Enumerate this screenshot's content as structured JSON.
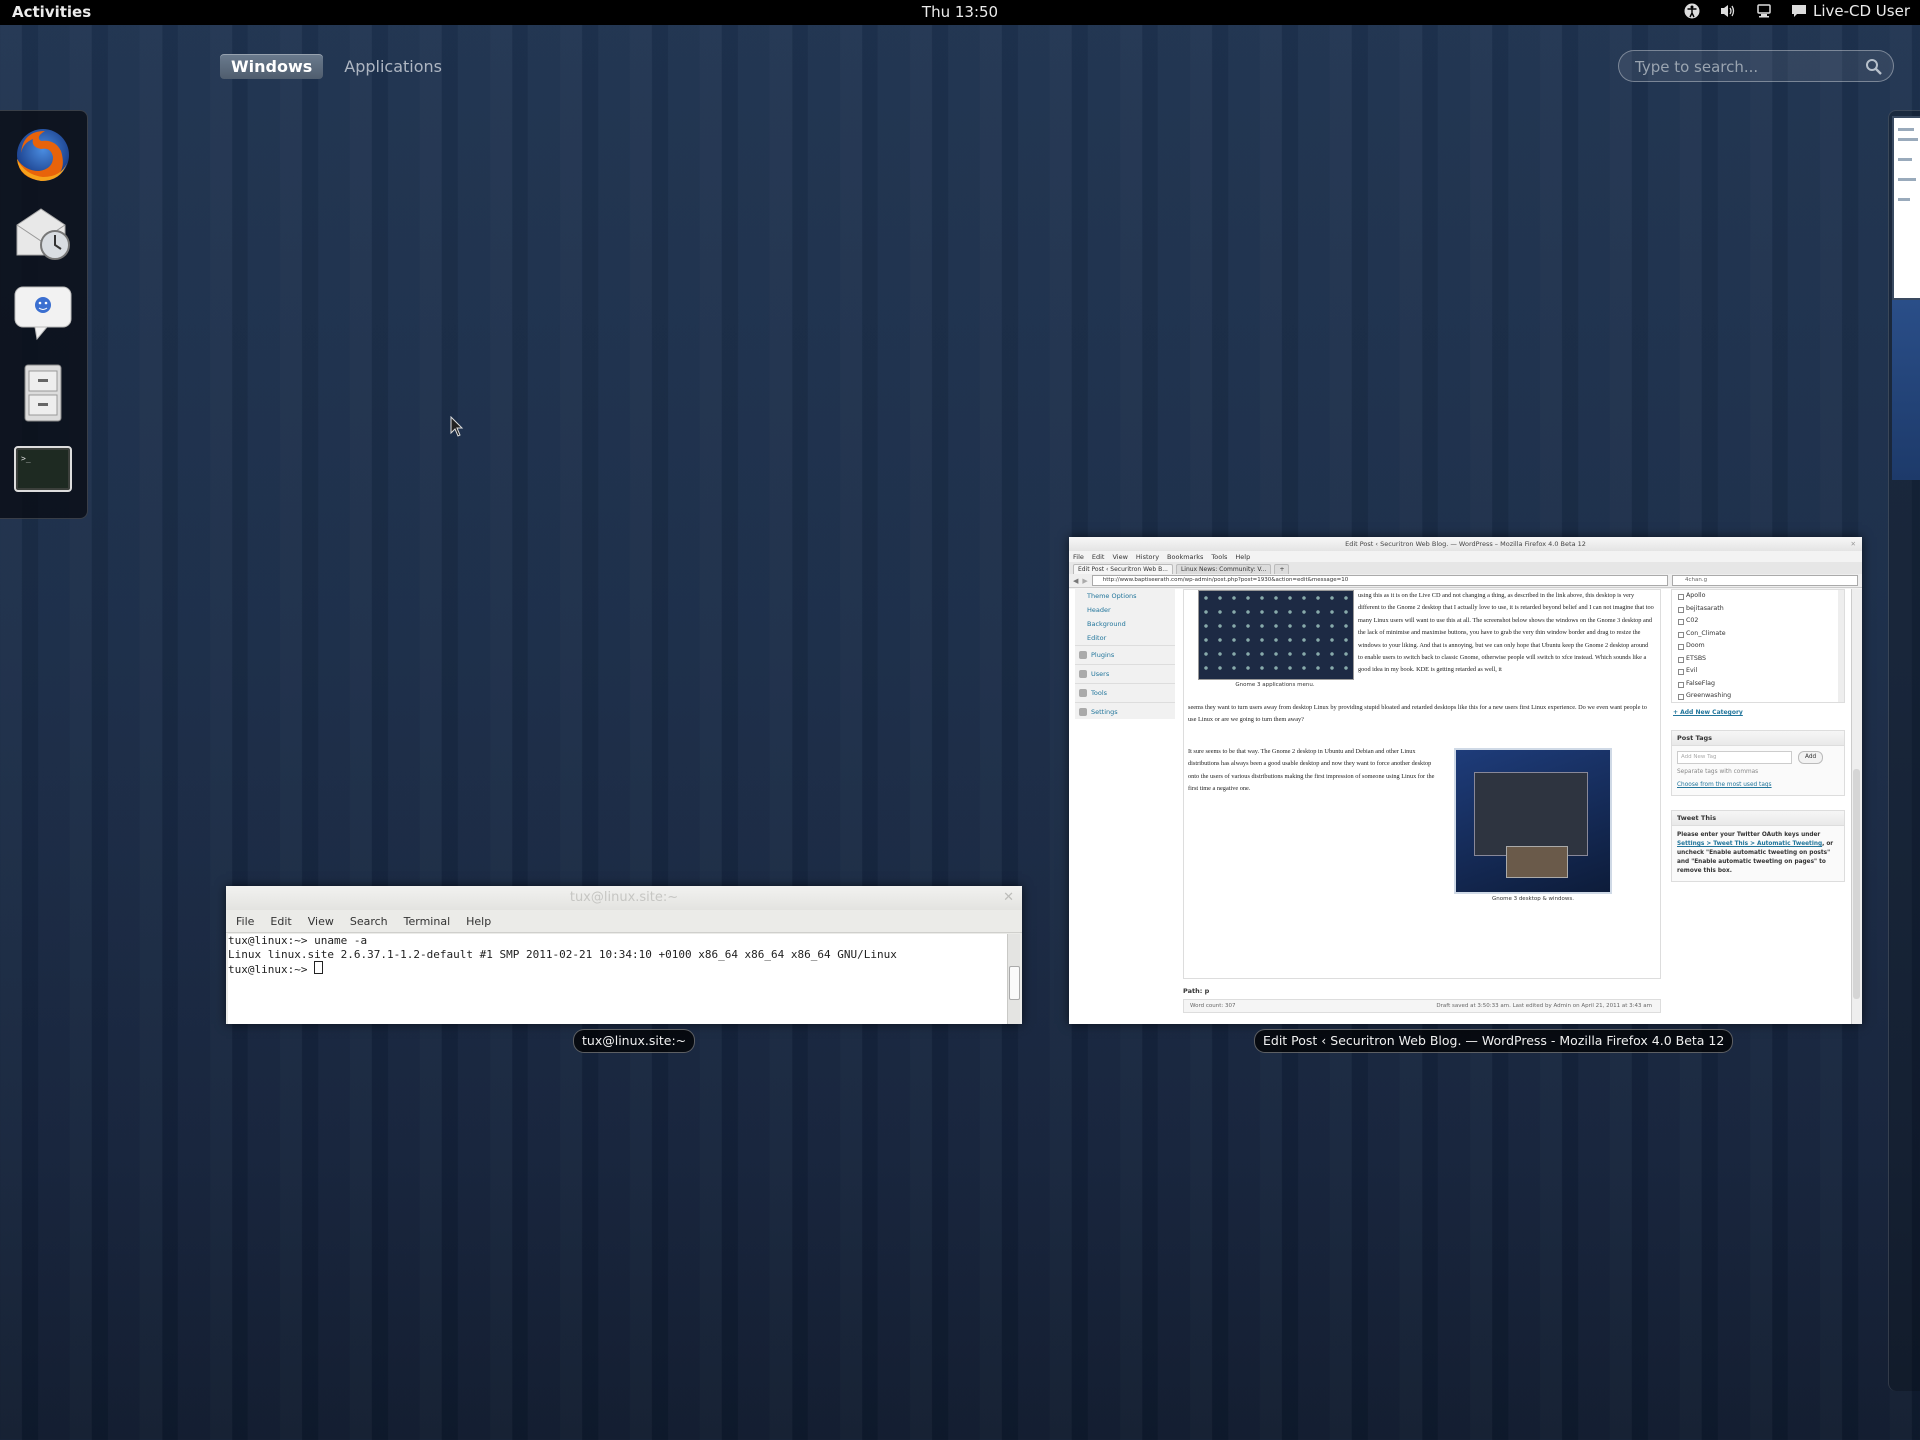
{
  "topbar": {
    "activities": "Activities",
    "clock": "Thu 13:50",
    "user": "Live-CD User",
    "icons": [
      "accessibility-icon",
      "volume-icon",
      "network-icon",
      "user-status-icon"
    ]
  },
  "overview": {
    "tabs": [
      {
        "label": "Windows",
        "active": true
      },
      {
        "label": "Applications",
        "active": false
      }
    ],
    "search_placeholder": "Type to search..."
  },
  "dash": {
    "items": [
      {
        "icon": "firefox-icon"
      },
      {
        "icon": "evolution-mail-icon"
      },
      {
        "icon": "empathy-chat-icon"
      },
      {
        "icon": "file-manager-icon"
      },
      {
        "icon": "terminal-icon"
      }
    ]
  },
  "terminal": {
    "title": "tux@linux.site:~",
    "label": "tux@linux.site:~",
    "menu": [
      "File",
      "Edit",
      "View",
      "Search",
      "Terminal",
      "Help"
    ],
    "lines": [
      "tux@linux:~> uname -a",
      "Linux linux.site 2.6.37.1-1.2-default #1 SMP 2011-02-21 10:34:10 +0100 x86_64 x86_64 x86_64 GNU/Linux",
      "tux@linux:~> "
    ]
  },
  "firefox": {
    "title": "Edit Post ‹ Securitron Web Blog. — WordPress – Mozilla Firefox 4.0 Beta 12",
    "label": "Edit Post ‹ Securitron Web Blog. — WordPress - Mozilla Firefox 4.0 Beta 12",
    "menu": [
      "File",
      "Edit",
      "View",
      "History",
      "Bookmarks",
      "Tools",
      "Help"
    ],
    "tabs": [
      "Edit Post ‹ Securitron Web B...",
      "Linux News: Community: V..."
    ],
    "url": "http://www.baptiseerath.com/wp-admin/post.php?post=1930&action=edit&message=10",
    "search_value": "4chan.g",
    "admin_menu": {
      "sub": [
        "Theme Options",
        "Header",
        "Background",
        "Editor"
      ],
      "main": [
        "Plugins",
        "Users",
        "Tools",
        "Settings"
      ]
    },
    "caption1": "Gnome 3 applications menu.",
    "para1": "using this as it is on the Live CD and not changing a thing, as described in the link above, this desktop is very different to the Gnome 2 desktop that I actually love to use, it is retarded beyond belief and I can not imagine that too many Linux users will want to use this at all. The screenshot below shows the windows on the Gnome 3 desktop and the lack of minimise and maximise buttons, you have to grab the very thin window border and drag to resize the windows to your liking. And that is annoying, but we can only hope that Ubuntu keep the Gnome 2 desktop around to enable users to switch back to classic Gnome, otherwise people will switch to xfce instead. Which sounds like a good idea in my book. KDE is getting retarded as well, it",
    "para1b": "seems they want to turn users away from desktop Linux by providing stupid bloated and retarded desktops like this for a new users first Linux experience. Do we even want people to use Linux or are we going to turn them away?",
    "para2": "It sure seems to be that way. The Gnome 2 desktop in Ubuntu and Debian and other Linux distributions has always been a good usable desktop and now they want to force another desktop onto the users of various distributions making the first impression of someone using Linux for the first time a negative one.",
    "caption2": "Gnome 3 desktop & windows.",
    "path": "Path: p",
    "word_count": "Word count: 307",
    "draft_saved": "Draft saved at 3:50:33 am. Last edited by Admin on April 21, 2011 at 3:43 am",
    "categories": [
      "Apollo",
      "bejitasarath",
      "C02",
      "Con_Climate",
      "Doom",
      "ETSBS",
      "Evil",
      "FalseFlag",
      "Greenwashing"
    ],
    "add_category": "+ Add New Category",
    "post_tags": {
      "title": "Post Tags",
      "placeholder": "Add New Tag",
      "add": "Add",
      "hint": "Separate tags with commas",
      "choose": "Choose from the most used tags"
    },
    "tweet_this": {
      "title": "Tweet This",
      "text1": "Please enter your Twitter OAuth keys under",
      "link": "Settings > Tweet This > Automatic Tweeting",
      "text2": ", or uncheck \"Enable automatic tweeting on posts\" and \"Enable automatic tweeting on pages\" to remove this box."
    }
  }
}
